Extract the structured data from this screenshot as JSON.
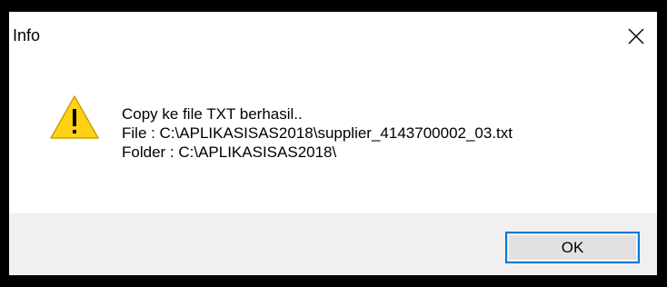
{
  "dialog": {
    "title": "Info",
    "close_icon": "close-icon",
    "icon": "warning-icon",
    "message_lines": [
      "Copy ke file TXT berhasil..",
      "File : C:\\APLIKASISAS2018\\supplier_4143700002_03.txt",
      "Folder : C:\\APLIKASISAS2018\\"
    ],
    "ok_label": "OK"
  },
  "colors": {
    "accent": "#0078d7",
    "warning": "#fcd116",
    "footer_bg": "#f0f0f0"
  }
}
